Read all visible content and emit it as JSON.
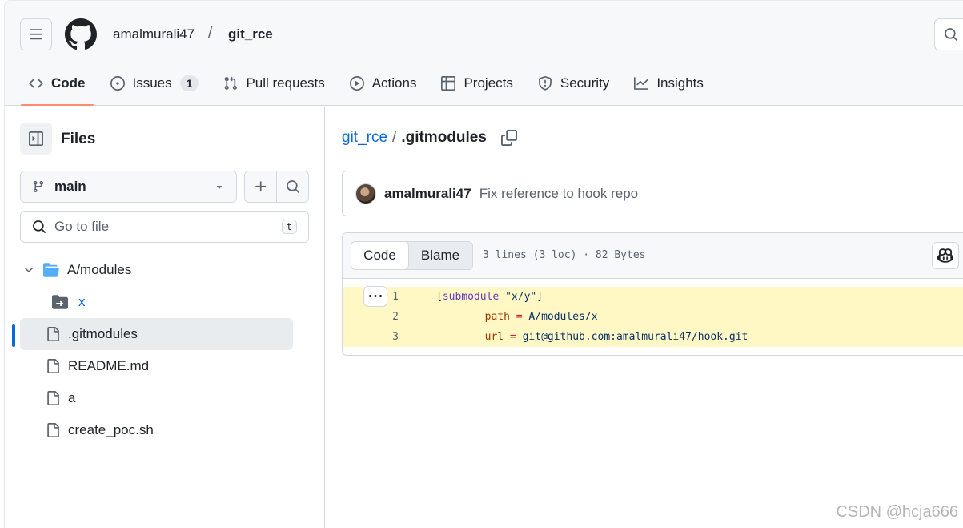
{
  "header": {
    "owner": "amalmurali47",
    "separator": "/",
    "repo": "git_rce"
  },
  "tabs": [
    {
      "label": "Code",
      "icon": "code-icon",
      "active": true
    },
    {
      "label": "Issues",
      "icon": "issue-icon",
      "count": "1"
    },
    {
      "label": "Pull requests",
      "icon": "pull-request-icon"
    },
    {
      "label": "Actions",
      "icon": "play-icon"
    },
    {
      "label": "Projects",
      "icon": "table-icon"
    },
    {
      "label": "Security",
      "icon": "shield-icon"
    },
    {
      "label": "Insights",
      "icon": "graph-icon"
    }
  ],
  "sidebar": {
    "title": "Files",
    "branch": "main",
    "search_placeholder": "Go to file",
    "search_shortcut": "t",
    "tree": [
      {
        "label": "A/modules",
        "type": "folder-open"
      },
      {
        "label": "x",
        "type": "submodule"
      },
      {
        "label": ".gitmodules",
        "type": "file",
        "selected": true
      },
      {
        "label": "README.md",
        "type": "file"
      },
      {
        "label": "a",
        "type": "file"
      },
      {
        "label": "create_poc.sh",
        "type": "file"
      }
    ]
  },
  "breadcrumb": {
    "root": "git_rce",
    "sep": "/",
    "file": ".gitmodules"
  },
  "commit": {
    "author": "amalmurali47",
    "message": "Fix reference to hook repo"
  },
  "file_view": {
    "code_tab": "Code",
    "blame_tab": "Blame",
    "info": "3 lines (3 loc) · 82 Bytes",
    "lines": [
      {
        "num": "1"
      },
      {
        "num": "2"
      },
      {
        "num": "3"
      }
    ],
    "line1": {
      "open": "[",
      "kw": "submodule",
      "space": " ",
      "str": "\"x/y\"",
      "close": "]"
    },
    "line2": {
      "indent": "        ",
      "key": "path",
      "eq": " = ",
      "val": "A/modules/x"
    },
    "line3": {
      "indent": "        ",
      "key": "url",
      "eq": " = ",
      "val": "git@github.com:amalmurali47/hook.git"
    }
  },
  "watermark": "CSDN @hcja666",
  "colors": {
    "accent": "#0969da",
    "tab_underline": "#fd8c73",
    "highlight": "#fff8c5"
  }
}
